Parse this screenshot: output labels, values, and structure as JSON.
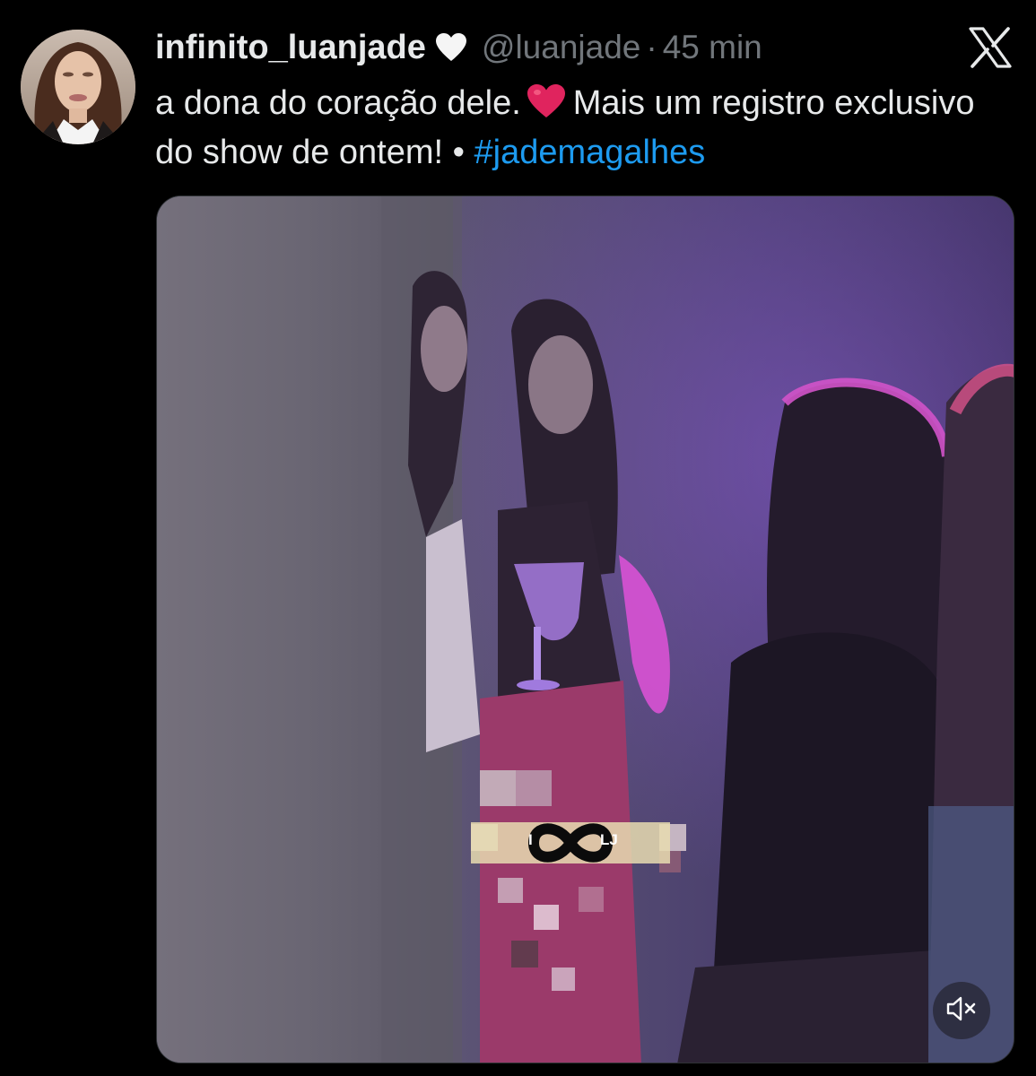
{
  "tweet": {
    "display_name": "infinito_luanjade",
    "name_badge_icon": "white-heart-icon",
    "handle": "@luanjade",
    "separator": "·",
    "time": "45 min",
    "text_part1": "a dona do coração dele.",
    "emoji_icon": "red-heart-icon",
    "text_part2": "Mais um registro exclusivo do show de ontem! •",
    "hashtag": "#jademagalhes"
  },
  "media": {
    "type": "video",
    "watermark_letters": [
      "I",
      "LJ"
    ],
    "mute_icon": "speaker-muted-icon"
  },
  "branding": {
    "logo_icon": "x-logo-icon"
  },
  "colors": {
    "background": "#000000",
    "text": "#e7e9ea",
    "secondary_text": "#71767b",
    "link": "#1d9bf0",
    "heart_red": "#e0245e"
  }
}
